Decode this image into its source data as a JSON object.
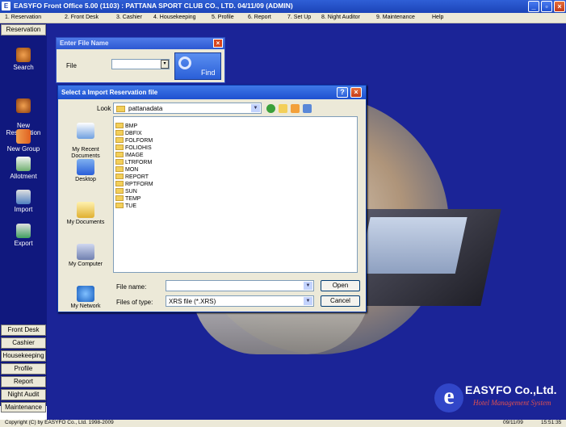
{
  "window": {
    "title": "EASYFO Front Office 5.00 (1103) : PATTANA SPORT CLUB CO., LTD.  04/11/09 (ADMIN)",
    "app_icon": "E"
  },
  "menu": [
    "1. Reservation",
    "2. Front Desk",
    "3. Cashier",
    "4. Housekeeping",
    "5. Profile",
    "6. Report",
    "7. Set Up",
    "8. Night Auditor",
    "9. Maintenance",
    "Help"
  ],
  "sidebar": {
    "header": "Reservation",
    "items": [
      "Search",
      "New\nReservation",
      "New Group",
      "Allotment",
      "Import",
      "Export"
    ],
    "bottom_buttons": [
      "Front Desk",
      "Cashier",
      "Housekeeping",
      "Profile",
      "Report",
      "Night Audit",
      "Maintenance"
    ]
  },
  "file_name_dialog": {
    "title": "Enter File Name",
    "file_label": "File",
    "file_value": "",
    "find_label": "Find"
  },
  "import_dialog": {
    "title": "Select a Import Reservation file",
    "look_in_label": "Look in:",
    "look_in_value": "pattanadata",
    "places": [
      "My Recent\nDocuments",
      "Desktop",
      "My Documents",
      "My Computer",
      "My Network"
    ],
    "folders": [
      "BMP",
      "DBFIX",
      "FOLFORM",
      "FOLIOHIS",
      "IMAGE",
      "LTRFORM",
      "MON",
      "REPORT",
      "RPTFORM",
      "SUN",
      "TEMP",
      "TUE"
    ],
    "file_name_label": "File name:",
    "file_name_value": "",
    "file_type_label": "Files of type:",
    "file_type_value": "XRS file (*.XRS)",
    "open_label": "Open",
    "cancel_label": "Cancel"
  },
  "logo": {
    "name": "EASYFO Co.,Ltd.",
    "tagline": "Hotel Management System"
  },
  "status": {
    "copyright": "Copyright (C) by EASYFO Co., Ltd. 1998-2009",
    "date": "09/11/09",
    "time": "15:51:35"
  },
  "colors": {
    "desktop": "#1b2497",
    "sidebar": "#10187e",
    "titlebar": "#2d58d2"
  }
}
